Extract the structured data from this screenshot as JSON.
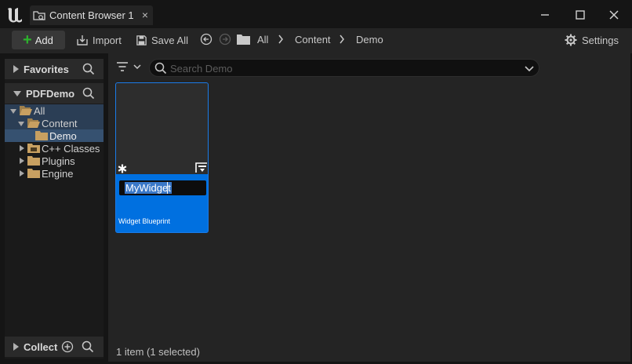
{
  "titlebar": {
    "tab_label": "Content Browser 1",
    "tab_close": "×"
  },
  "toolbar": {
    "add_label": "Add",
    "import_label": "Import",
    "save_all_label": "Save All",
    "breadcrumbs": [
      "All",
      "Content",
      "Demo"
    ],
    "settings_label": "Settings"
  },
  "sidebar": {
    "favorites_label": "Favorites",
    "project_label": "PDFDemo",
    "tree": [
      {
        "label": "All"
      },
      {
        "label": "Content"
      },
      {
        "label": "Demo"
      },
      {
        "label": "C++ Classes"
      },
      {
        "label": "Plugins"
      },
      {
        "label": "Engine"
      }
    ],
    "collect_label": "Collect"
  },
  "content": {
    "search_placeholder": "Search Demo",
    "asset": {
      "name": "MyWidget",
      "type": "Widget Blueprint"
    },
    "status": "1 item (1 selected)"
  },
  "colors": {
    "accent": "#0070e0",
    "add_green": "#2db32d",
    "folder": "#c8a061"
  }
}
